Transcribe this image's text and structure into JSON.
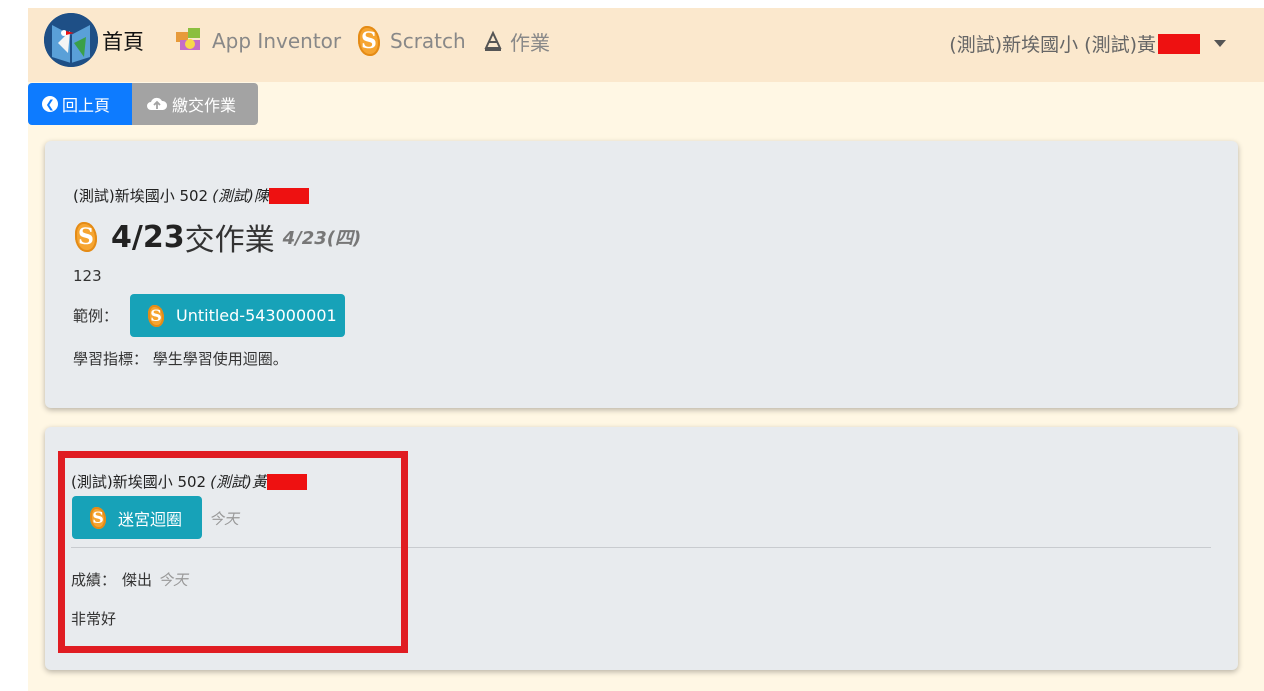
{
  "nav": {
    "home": "首頁",
    "app_inventor": "App Inventor",
    "scratch": "Scratch",
    "homework": "作業",
    "user": "(測試)新埃國小 (測試)黃"
  },
  "toolbar": {
    "back": "回上頁",
    "submit": "繳交作業"
  },
  "assignment": {
    "school": "(測試)新埃國小 502",
    "teacher": "(測試)陳",
    "title_bold": "4/23",
    "title_rest": "交作業",
    "date": "4/23(四)",
    "description": "123",
    "example_label": "範例：",
    "example_project": "Untitled-543000001",
    "objective": "學習指標： 學生學習使用迴圈。"
  },
  "submission": {
    "school": "(測試)新埃國小 502",
    "student": "(測試)黃",
    "project": "迷宮迴圈",
    "submitted_when": "今天",
    "grade_label": "成績：",
    "grade": "傑出",
    "graded_when": "今天",
    "comment": "非常好"
  },
  "colors": {
    "navbar": "#fbe8cd",
    "page": "#fff7e4",
    "primary": "#0d7bff",
    "info": "#17a2b8",
    "secondary": "#a3a3a3",
    "redaction": "#ee1111",
    "highlight": "#e01c22"
  },
  "icons": [
    "site-logo-icon",
    "app-inventor-icon",
    "scratch-icon",
    "homework-icon",
    "chevron-left-circle-icon",
    "cloud-upload-icon",
    "caret-down-icon"
  ]
}
